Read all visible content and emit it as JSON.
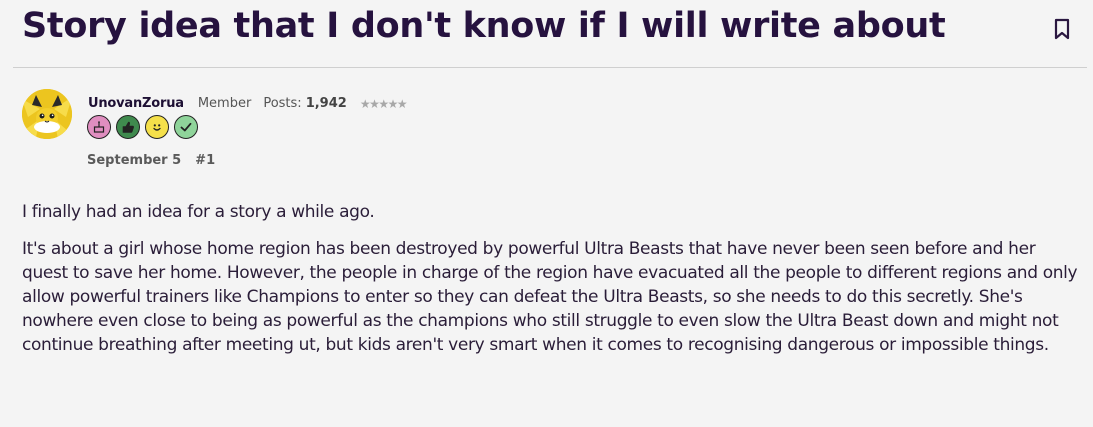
{
  "thread": {
    "title": "Story idea that I don't know if I will write about"
  },
  "post": {
    "author": {
      "username": "UnovanZorua",
      "role": "Member",
      "posts_label": "Posts:",
      "posts_count": "1,942",
      "stars": "★★★★★",
      "badges": [
        "cake-badge-icon",
        "thumbs-up-badge-icon",
        "smiley-badge-icon",
        "checkmark-badge-icon"
      ]
    },
    "date": "September 5",
    "number": "#1",
    "paragraphs": [
      "I finally had an idea for a story a while ago.",
      "It's about a girl whose home region has been destroyed by powerful Ultra Beasts that have never been seen before and her quest to save her home. However, the people in charge of the region have evacuated all the people to different regions and only allow powerful trainers like Champions to enter so they can defeat the Ultra Beasts, so she needs to do this secretly. She's nowhere even close to being as powerful as the champions who still struggle to even slow the Ultra Beast down and might not continue breathing after meeting ut, but kids aren't very smart when it comes to recognising dangerous or impossible things."
    ]
  },
  "colors": {
    "title": "#26123f",
    "background": "#f4f4f4",
    "badge_cake": "#e08ec0",
    "badge_thumbs": "#3f8a4e",
    "badge_smiley": "#f5e04a",
    "badge_check": "#8fd49a"
  }
}
